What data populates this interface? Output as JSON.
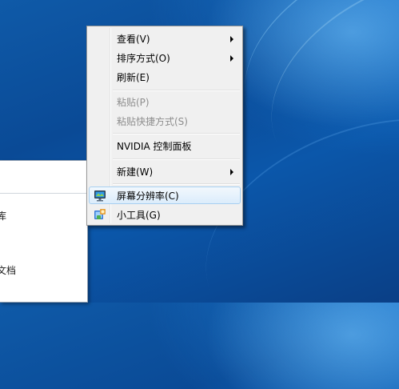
{
  "side_window": {
    "row1_text": "库",
    "row2_text": "文档"
  },
  "context_menu": {
    "items": [
      {
        "label": "查看(V)",
        "submenu": true,
        "enabled": true
      },
      {
        "label": "排序方式(O)",
        "submenu": true,
        "enabled": true
      },
      {
        "label": "刷新(E)",
        "submenu": false,
        "enabled": true
      },
      {
        "label": "粘贴(P)",
        "submenu": false,
        "enabled": false
      },
      {
        "label": "粘贴快捷方式(S)",
        "submenu": false,
        "enabled": false
      },
      {
        "label": "NVIDIA 控制面板",
        "submenu": false,
        "enabled": true
      },
      {
        "label": "新建(W)",
        "submenu": true,
        "enabled": true
      },
      {
        "label": "屏幕分辨率(C)",
        "submenu": false,
        "enabled": true,
        "icon": "monitor-icon",
        "highlighted": true
      },
      {
        "label": "小工具(G)",
        "submenu": false,
        "enabled": true,
        "icon": "gadgets-icon"
      }
    ]
  },
  "colors": {
    "desktop_blue": "#0a4a96",
    "menu_background": "#f0f0f0",
    "disabled_text": "#8d8d8d",
    "highlight_border": "#a8d0f1"
  }
}
